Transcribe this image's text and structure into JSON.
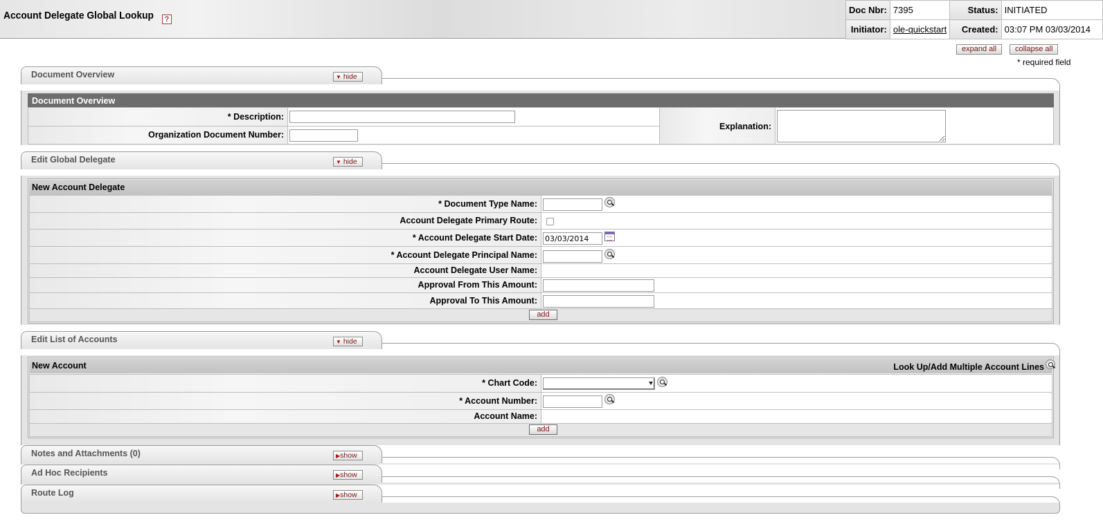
{
  "header": {
    "title": "Account Delegate Global Lookup",
    "help_icon": "help-icon",
    "doc_nbr_label": "Doc Nbr:",
    "doc_nbr": "7395",
    "status_label": "Status:",
    "status": "INITIATED",
    "initiator_label": "Initiator:",
    "initiator": "ole-quickstart",
    "created_label": "Created:",
    "created": "03:07 PM 03/03/2014"
  },
  "global": {
    "expand_all": "expand all",
    "collapse_all": "collapse all",
    "required_note": "* required field"
  },
  "doc_overview": {
    "tab_label": "Document Overview",
    "toggle": "hide",
    "section_title": "Document Overview",
    "description_label": "* Description:",
    "description_value": "",
    "org_doc_label": "Organization Document Number:",
    "org_doc_value": "",
    "explanation_label": "Explanation:",
    "explanation_value": ""
  },
  "edit_global_delegate": {
    "tab_label": "Edit Global Delegate",
    "toggle": "hide",
    "section_title": "New Account Delegate",
    "fields": {
      "doc_type_label": "* Document Type Name:",
      "doc_type_value": "",
      "primary_route_label": "Account Delegate Primary Route:",
      "start_date_label": "* Account Delegate Start Date:",
      "start_date_value": "03/03/2014",
      "principal_label": "* Account Delegate Principal Name:",
      "principal_value": "",
      "user_name_label": "Account Delegate User Name:",
      "approval_from_label": "Approval From This Amount:",
      "approval_from_value": "",
      "approval_to_label": "Approval To This Amount:",
      "approval_to_value": ""
    },
    "add_label": "add"
  },
  "edit_list_accounts": {
    "tab_label": "Edit List of Accounts",
    "toggle": "hide",
    "section_title": "New Account",
    "multi_lookup_label": "Look Up/Add Multiple Account Lines",
    "chart_code_label": "* Chart Code:",
    "chart_code_value": "",
    "account_number_label": "* Account Number:",
    "account_number_value": "",
    "account_name_label": "Account Name:",
    "add_label": "add"
  },
  "collapsed_tabs": [
    {
      "label": "Notes and Attachments (0)",
      "toggle": "show"
    },
    {
      "label": "Ad Hoc Recipients",
      "toggle": "show"
    },
    {
      "label": "Route Log",
      "toggle": "show"
    }
  ]
}
